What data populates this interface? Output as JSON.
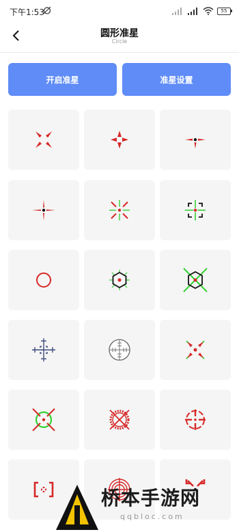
{
  "status_bar": {
    "time": "下午1:53",
    "battery": "55"
  },
  "header": {
    "title": "圆形准星",
    "subtitle": "Circle"
  },
  "actions": {
    "enable_label": "开启准星",
    "settings_label": "准星设置"
  },
  "colors": {
    "accent": "#5f8cf7",
    "tile_bg": "#f5f5f5",
    "red": "#d62828",
    "green": "#35d135"
  },
  "crosshairs": [
    "red-x-arrows",
    "red-cross-arrows",
    "red-cross-dot",
    "red-plus-dot",
    "red-green-star",
    "green-bracket-box",
    "red-circle",
    "black-hexagon",
    "green-hexagon-x",
    "navy-scope-ticks",
    "gray-circle-scope",
    "red-green-x-dot",
    "green-circle-x",
    "red-gear-ring",
    "red-cross-circle",
    "red-brackets",
    "red-target-rings",
    "red-skull-x"
  ],
  "watermark": {
    "text": "桥本手游网",
    "url": "qqbloc.com"
  }
}
